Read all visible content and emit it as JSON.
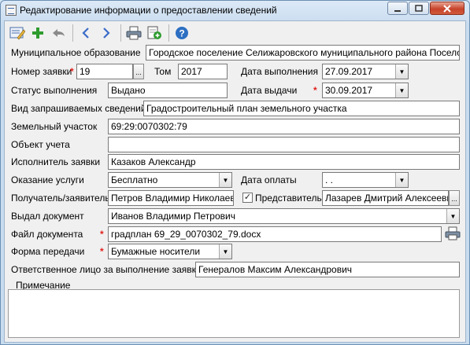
{
  "window": {
    "title": "Редактирование информации о предоставлении сведений"
  },
  "toolbar": {
    "buttons": [
      {
        "name": "edit",
        "icon": "edit-form-icon"
      },
      {
        "name": "add",
        "icon": "plus-icon",
        "color": "#2e9b2e"
      },
      {
        "name": "undo",
        "icon": "undo-arrow-icon"
      },
      {
        "name": "previous",
        "icon": "chevron-left-icon",
        "color": "#3b6cc9"
      },
      {
        "name": "next",
        "icon": "chevron-right-icon",
        "color": "#3b6cc9"
      },
      {
        "name": "print",
        "icon": "printer-icon"
      },
      {
        "name": "export",
        "icon": "export-document-icon"
      },
      {
        "name": "help",
        "icon": "help-icon",
        "color": "#2d6fc2"
      }
    ]
  },
  "form": {
    "municipality": {
      "label": "Муниципальное образование",
      "value": "Городское поселение Селижаровского муниципального района Поселок Сел"
    },
    "request_number": {
      "label": "Номер заявки",
      "value": "19"
    },
    "volume": {
      "label": "Том",
      "value": "2017"
    },
    "completion_date": {
      "label": "Дата выполнения",
      "value": "27.09.2017"
    },
    "status": {
      "label": "Статус выполнения",
      "value": "Выдано"
    },
    "issue_date": {
      "label": "Дата выдачи",
      "value": "30.09.2017"
    },
    "info_type": {
      "label": "Вид запрашиваемых сведений",
      "value": "Градостроительный план земельного участка"
    },
    "land_plot": {
      "label": "Земельный участок",
      "value": "69:29:0070302:79"
    },
    "accounting_object": {
      "label": "Объект учета",
      "value": ""
    },
    "executor": {
      "label": "Исполнитель заявки",
      "value": "Казаков Александр"
    },
    "service_provision": {
      "label": "Оказание услуги",
      "value": "Бесплатно"
    },
    "payment_date": {
      "label": "Дата оплаты",
      "value": " .  ."
    },
    "recipient": {
      "label": "Получатель/заявитель",
      "value": "Петров Владимир Николаеви"
    },
    "representative": {
      "label": "Представитель",
      "checked": true,
      "value": "Лазарев Дмитрий Алексеевич"
    },
    "issued_document": {
      "label": "Выдал документ",
      "value": "Иванов Владимир Петрович"
    },
    "document_file": {
      "label": "Файл документа",
      "value": "градплан 69_29_0070302_79.docx"
    },
    "transfer_form": {
      "label": "Форма передачи",
      "value": "Бумажные носители"
    },
    "responsible": {
      "label": "Ответственное лицо за выполнение заявки",
      "value": "Генералов Максим Александрович"
    },
    "notes": {
      "label": "Примечание",
      "value": ""
    }
  },
  "required_mark": "*"
}
